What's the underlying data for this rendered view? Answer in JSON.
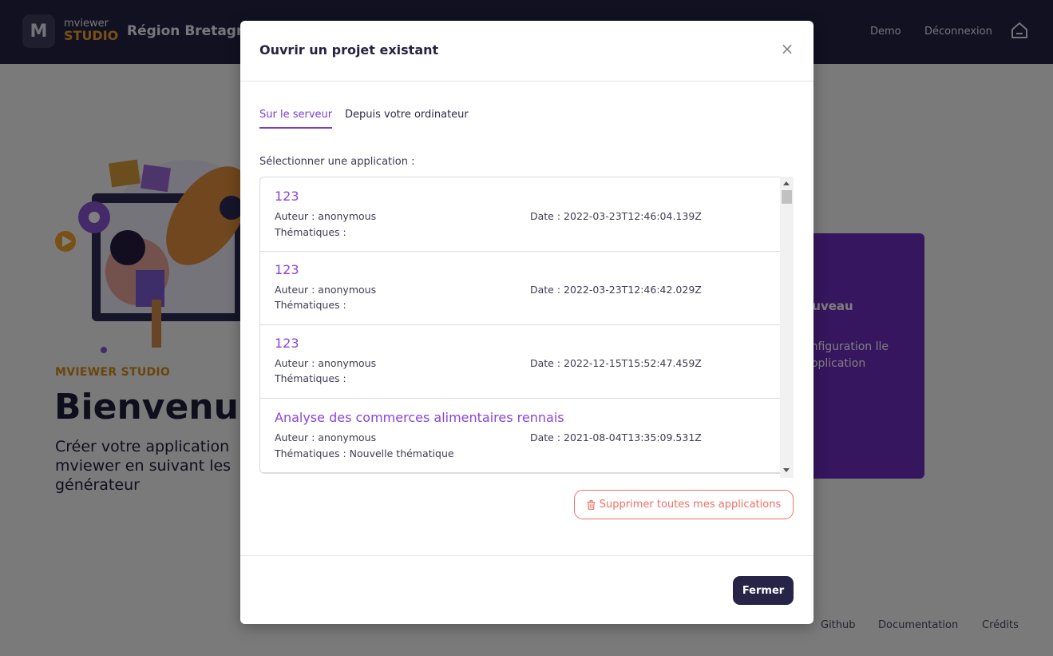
{
  "topbar": {
    "logo_letter": "M",
    "logo_top": "mviewer",
    "logo_bottom": "STUDIO",
    "region": "Région Bretagne",
    "nav_demo": "Demo",
    "nav_logout": "Déconnexion",
    "home_icon": "home-icon"
  },
  "hero": {
    "label": "MVIEWER STUDIO",
    "title": "Bienvenue",
    "subtitle": "Créer votre application mviewer en suivant les générateur"
  },
  "card": {
    "title": "ouveau",
    "text": "onfiguration lle application"
  },
  "footer": {
    "github": "Github",
    "documentation": "Documentation",
    "credits": "Crédits"
  },
  "modal": {
    "title": "Ouvrir un projet existant",
    "close_icon": "×",
    "tabs": [
      {
        "label": "Sur le serveur",
        "active": true
      },
      {
        "label": "Depuis votre ordinateur",
        "active": false
      }
    ],
    "select_label": "Sélectionner une application :",
    "applications": [
      {
        "name": "123",
        "author": "Auteur : anonymous",
        "date": "Date : 2022-03-23T12:46:04.139Z",
        "themes": "Thématiques :"
      },
      {
        "name": "123",
        "author": "Auteur : anonymous",
        "date": "Date : 2022-03-23T12:46:42.029Z",
        "themes": "Thématiques :"
      },
      {
        "name": "123",
        "author": "Auteur : anonymous",
        "date": "Date : 2022-12-15T15:52:47.459Z",
        "themes": "Thématiques :"
      },
      {
        "name": "Analyse des commerces alimentaires rennais",
        "author": "Auteur : anonymous",
        "date": "Date : 2021-08-04T13:35:09.531Z",
        "themes": "Thématiques : Nouvelle thématique"
      }
    ],
    "delete_all_label": "Supprimer toutes mes applications",
    "close_button_label": "Fermer"
  },
  "colors": {
    "accent": "#7b3cd3",
    "topbar": "#242345",
    "danger": "#f06f63",
    "brand_orange": "#f2a12b"
  }
}
